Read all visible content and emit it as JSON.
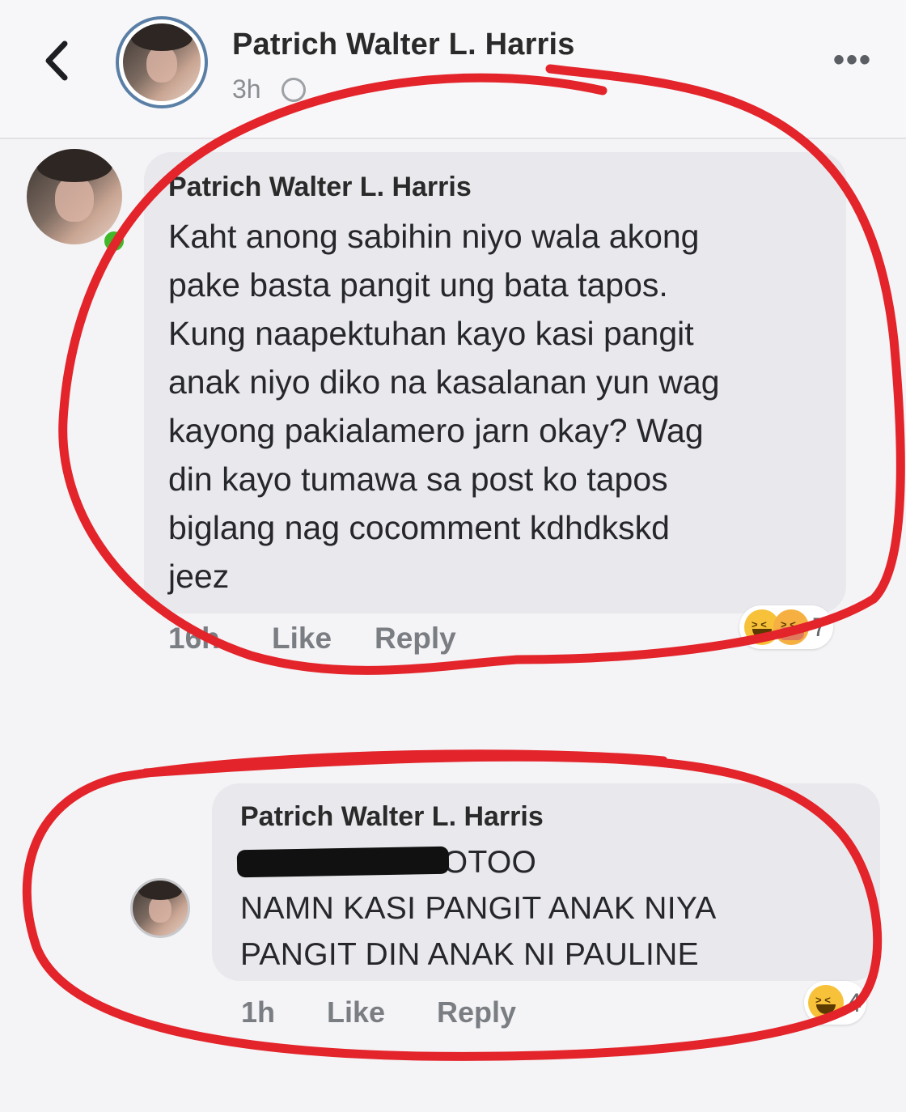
{
  "post": {
    "author": "Patrich Walter L. Harris",
    "time": "3h",
    "more_label": "•••"
  },
  "comments": [
    {
      "author": "Patrich Walter L. Harris",
      "text": "Kaht anong sabihin niyo wala akong\npake basta pangit ung bata tapos.\nKung naapektuhan kayo kasi pangit\nanak niyo diko na kasalanan yun wag\nkayong pakialamero jarn okay? Wag\ndin kayo tumawa sa post ko tapos\nbiglang nag cocomment kdhdkskd\njeez",
      "time": "16h",
      "like_label": "Like",
      "reply_label": "Reply",
      "reactions": [
        "haha-icon",
        "care-icon"
      ],
      "reaction_count": "7"
    },
    {
      "author": "Patrich Walter L. Harris",
      "text": "                      HAHAHAHA TOTOO\nNAMN KASI PANGIT ANAK NIYA\nPANGIT DIN ANAK NI PAULINE",
      "time": "1h",
      "like_label": "Like",
      "reply_label": "Reply",
      "reactions": [
        "haha-icon"
      ],
      "reaction_count": "4"
    }
  ],
  "colors": {
    "annotation_red": "#e3242b",
    "online_green": "#42b72a",
    "bubble_gray": "#e9e9ed"
  }
}
